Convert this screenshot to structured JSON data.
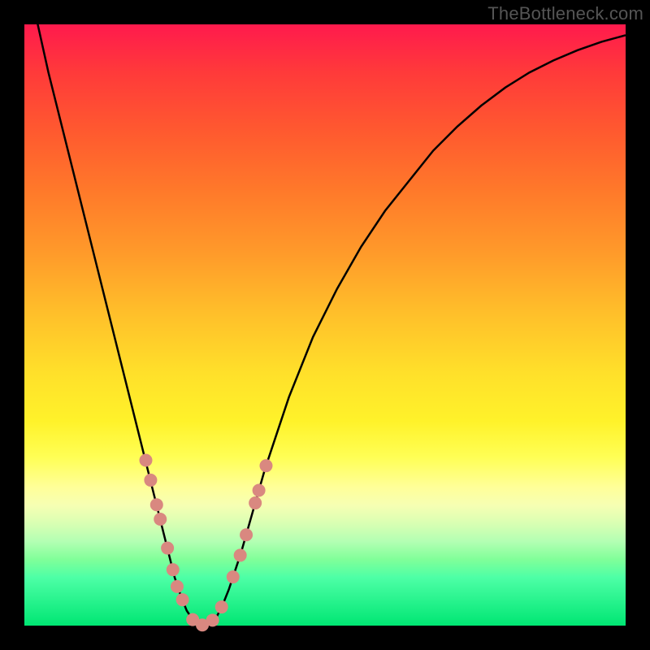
{
  "watermark": "TheBottleneck.com",
  "colors": {
    "background": "#000000",
    "curve_stroke": "#000000",
    "point_fill": "#d98880",
    "point_stroke": "#d98880"
  },
  "chart_data": {
    "type": "line",
    "title": "",
    "xlabel": "",
    "ylabel": "",
    "xlim": [
      0,
      100
    ],
    "ylim": [
      0,
      100
    ],
    "grid": false,
    "series": [
      {
        "name": "bottleneck-curve",
        "x": [
          0,
          2,
          4,
          6,
          8,
          10,
          12,
          14,
          16,
          18,
          20,
          22,
          24,
          25,
          26,
          27,
          28,
          29,
          30,
          31,
          32,
          33,
          34,
          36,
          38,
          40,
          42,
          44,
          48,
          52,
          56,
          60,
          64,
          68,
          72,
          76,
          80,
          84,
          88,
          92,
          96,
          100
        ],
        "y": [
          110,
          101,
          92,
          84,
          76,
          68,
          60,
          52,
          44,
          36,
          28,
          20,
          12,
          8,
          5,
          2.5,
          1,
          0.2,
          0,
          0.4,
          1.5,
          3.5,
          6,
          12,
          19,
          26,
          32,
          38,
          48,
          56,
          63,
          69,
          74,
          79,
          83,
          86.5,
          89.5,
          92,
          94,
          95.7,
          97.1,
          98.2
        ]
      }
    ],
    "points": [
      {
        "x": 20.2,
        "y": 27.5
      },
      {
        "x": 21.0,
        "y": 24.2
      },
      {
        "x": 22.0,
        "y": 20.1
      },
      {
        "x": 22.6,
        "y": 17.7
      },
      {
        "x": 23.8,
        "y": 12.9
      },
      {
        "x": 24.7,
        "y": 9.3
      },
      {
        "x": 25.4,
        "y": 6.5
      },
      {
        "x": 26.3,
        "y": 4.3
      },
      {
        "x": 28.0,
        "y": 1.0
      },
      {
        "x": 29.6,
        "y": 0.1
      },
      {
        "x": 31.3,
        "y": 0.9
      },
      {
        "x": 32.8,
        "y": 3.1
      },
      {
        "x": 34.7,
        "y": 8.1
      },
      {
        "x": 35.9,
        "y": 11.7
      },
      {
        "x": 36.9,
        "y": 15.1
      },
      {
        "x": 38.4,
        "y": 20.4
      },
      {
        "x": 39.0,
        "y": 22.5
      },
      {
        "x": 40.2,
        "y": 26.6
      }
    ],
    "point_radius_px": 8
  }
}
